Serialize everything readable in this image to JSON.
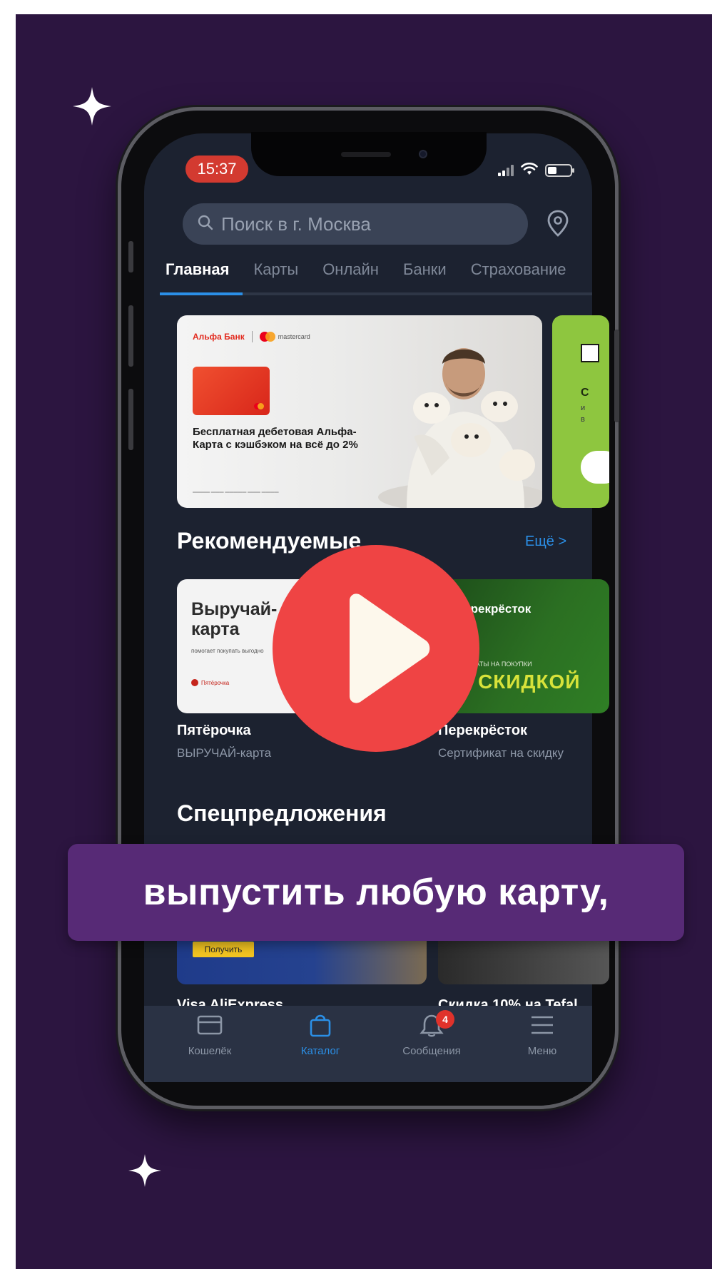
{
  "colors": {
    "background": "#2c1540",
    "screen": "#1c2230",
    "accent": "#2b8fe6",
    "play_button": "#ef4444",
    "caption_bg": "#572a76",
    "time_pill": "#d33a30"
  },
  "status_bar": {
    "time": "15:37"
  },
  "search": {
    "placeholder": "Поиск в г. Москва",
    "location_icon": "location-pin-icon"
  },
  "tabs": [
    {
      "label": "Главная",
      "active": true
    },
    {
      "label": "Карты",
      "active": false
    },
    {
      "label": "Онлайн",
      "active": false
    },
    {
      "label": "Банки",
      "active": false
    },
    {
      "label": "Страхование",
      "active": false
    }
  ],
  "banner": {
    "brand": "Альфа Банк",
    "partner": "mastercard",
    "text": "Бесплатная дебетовая Альфа-Карта с кэшбэком на всё до 2%"
  },
  "banner2": {
    "letter": "С",
    "sub1": "и",
    "sub2": "в"
  },
  "recommended": {
    "title": "Рекомендуемые",
    "more": "Ещё >",
    "items": [
      {
        "card_title": "Выручай-карта",
        "card_small": "помогает покупать выгодно",
        "card_logo": "Пятёрочка",
        "name": "Пятёрочка",
        "subtitle": "ВЫРУЧАЙ-карта"
      },
      {
        "card_brand": "Перекрёсток",
        "card_small": "СЕРТИФИКАТЫ НА ПОКУПКИ",
        "card_big": "СО СКИДКОЙ",
        "name": "Перекрёсток",
        "subtitle": "Сертификат на скидку"
      }
    ]
  },
  "special": {
    "title": "Спецпредложения",
    "items": [
      {
        "button": "Получить",
        "name": "Visa AliExpress"
      },
      {
        "name": "Скидка 10% на Tefal"
      }
    ]
  },
  "bottom_nav": [
    {
      "label": "Кошелёк",
      "icon": "wallet-icon",
      "active": false
    },
    {
      "label": "Каталог",
      "icon": "shopping-bag-icon",
      "active": true
    },
    {
      "label": "Сообщения",
      "icon": "bell-icon",
      "active": false,
      "badge": "4"
    },
    {
      "label": "Меню",
      "icon": "menu-icon",
      "active": false
    }
  ],
  "caption": "выпустить любую карту,"
}
